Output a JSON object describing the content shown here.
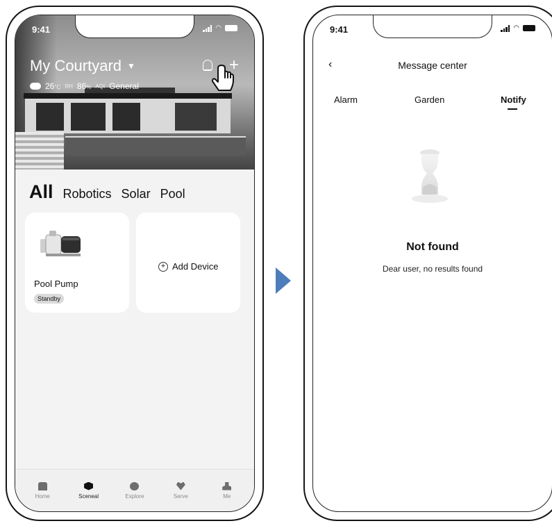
{
  "left_screen": {
    "status_time": "9:41",
    "title": "My Courtyard",
    "weather": {
      "temp": "26",
      "temp_unit": "°C",
      "rh_label": "RH",
      "rh": "86",
      "rh_unit": "%",
      "aqi_label": "AQI",
      "aqi": "General"
    },
    "tabs": [
      "All",
      "Robotics",
      "Solar",
      "Pool"
    ],
    "device_card": {
      "name": "Pool Pump",
      "status": "Standby"
    },
    "add_card": {
      "label": "Add Device"
    },
    "nav": [
      "Home",
      "Sceneal",
      "Explore",
      "Serve",
      "Me"
    ]
  },
  "right_screen": {
    "status_time": "9:41",
    "title": "Message center",
    "tabs": [
      "Alarm",
      "Garden",
      "Notify"
    ],
    "empty_title": "Not found",
    "empty_subtitle": "Dear user, no results found"
  },
  "colors": {
    "arrow": "#4d7dba",
    "badge_bg": "#dadada"
  },
  "icons": [
    "back-arrow-icon",
    "bell-icon",
    "plus-icon",
    "hand-pointer-icon",
    "plus-circle-icon",
    "hourglass-icon"
  ]
}
